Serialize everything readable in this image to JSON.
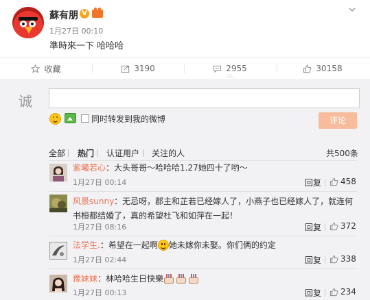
{
  "post": {
    "author": "蘇有朋",
    "verified_icon": "v-badge-icon",
    "time": "1月27日 00:10",
    "text": "準時來一下 哈哈哈"
  },
  "actions": {
    "favorite": "收藏",
    "repost_count": "3190",
    "comment_count": "2955",
    "like_count": "30158"
  },
  "comment_box": {
    "sincere_label": "诚",
    "input_value": "",
    "forward_label": "同时转发到我的微博",
    "submit_label": "评论"
  },
  "filters": {
    "all": "全部",
    "hot": "热门",
    "verified": "认证用户",
    "following": "关注的人",
    "total": "共500条"
  },
  "comments": [
    {
      "name": "紫曦若心",
      "text": "：大头哥哥～哈哈哈1.27她四十了哟～",
      "time": "1月27日 00:14",
      "reply": "回复",
      "likes": "458"
    },
    {
      "name": "风景sunny",
      "text": "：无忌呀，郡主和芷若已经嫁人了，小燕子也已经嫁人了，就连何书桓都结婚了，真的希望杜飞和如萍在一起！",
      "time": "1月27日 08:16",
      "reply": "回复",
      "likes": "372"
    },
    {
      "name": "法学生.",
      "text_before": "：希望在一起啊",
      "text_after": "她未嫁你未娶。你们俩的约定",
      "time": "1月27日 02:44",
      "reply": "回复",
      "likes": "338"
    },
    {
      "name": "豫妹妹",
      "text": "：林哈哈生日快樂",
      "time": "1月27日 00:13",
      "reply": "回复",
      "likes": "234"
    }
  ],
  "colors": {
    "accent": "#eb7350",
    "link_blue": "#eb7350",
    "panel_bg": "#f2f2f5",
    "submit_bg": "#f7bc9b"
  }
}
